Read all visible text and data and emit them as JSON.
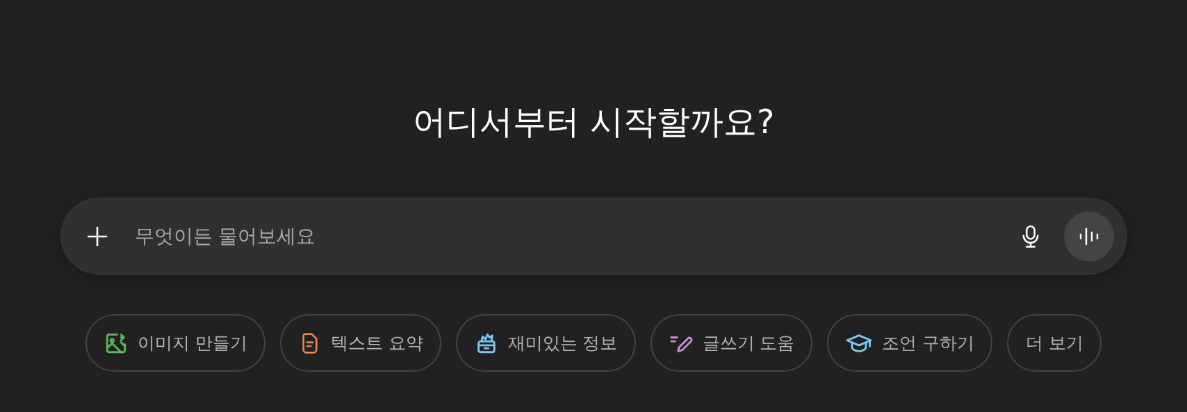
{
  "heading": "어디서부터 시작할까요?",
  "composer": {
    "placeholder": "무엇이든 물어보세요"
  },
  "suggestions": [
    {
      "kind": "image",
      "label": "이미지 만들기",
      "color": "#5cb85c"
    },
    {
      "kind": "summary",
      "label": "텍스트 요약",
      "color": "#e8884a"
    },
    {
      "kind": "fact",
      "label": "재미있는 정보",
      "color": "#7ec8ee"
    },
    {
      "kind": "writing",
      "label": "글쓰기 도움",
      "color": "#c68fd6"
    },
    {
      "kind": "advice",
      "label": "조언 구하기",
      "color": "#7ec8ee"
    },
    {
      "kind": "more",
      "label": "더 보기"
    }
  ]
}
